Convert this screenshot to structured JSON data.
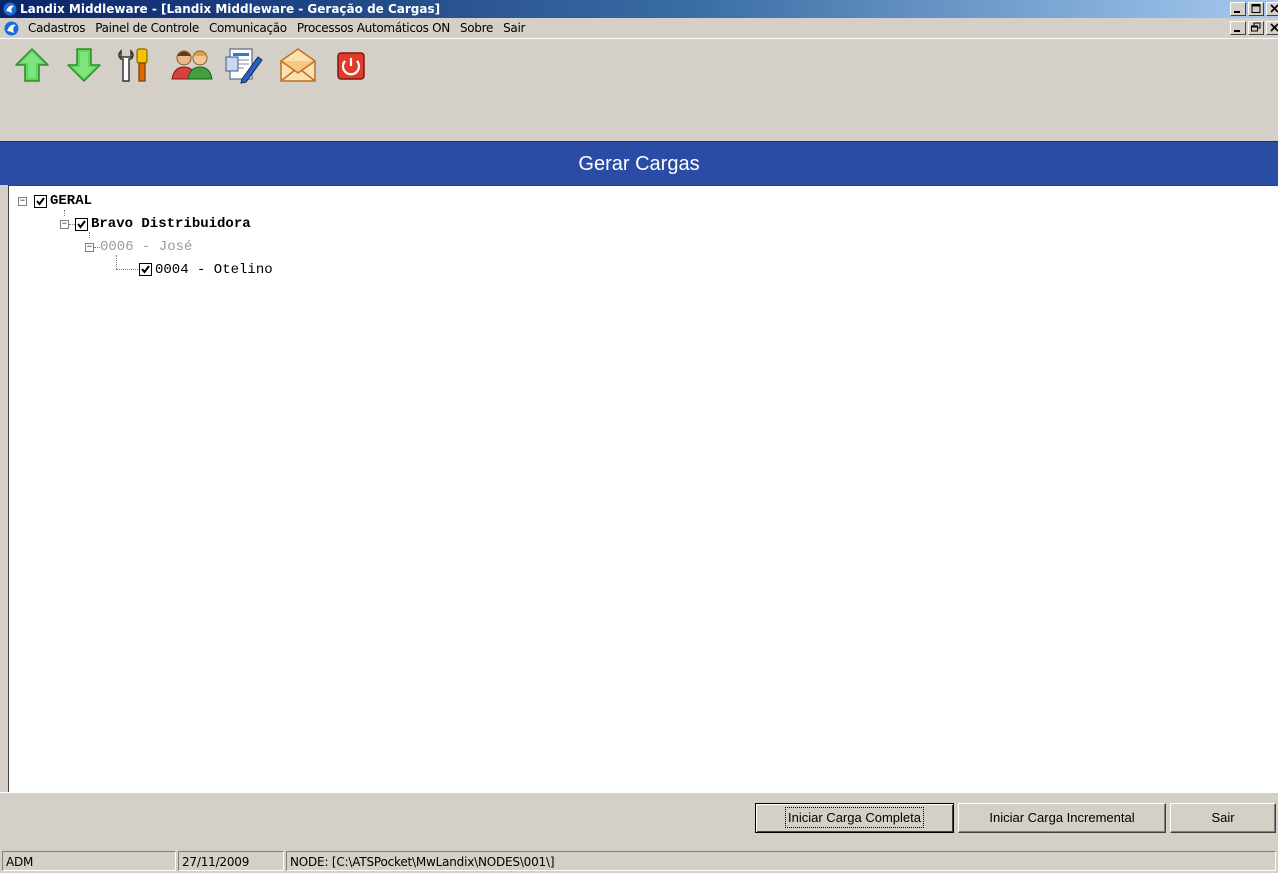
{
  "window": {
    "title": "Landix Middleware - [Landix Middleware - Geração de Cargas]"
  },
  "menu": {
    "items": [
      "Cadastros",
      "Painel de Controle",
      "Comunicação",
      "Processos Automáticos ON",
      "Sobre",
      "Sair"
    ]
  },
  "toolbar": {
    "buttons": [
      {
        "icon": "upload-arrow-icon",
        "color": "#34c234"
      },
      {
        "icon": "download-arrow-icon",
        "color": "#34c234"
      },
      {
        "icon": "tools-icon",
        "color": "#e8a000"
      },
      {
        "icon": "users-icon",
        "color": "#c8782c"
      },
      {
        "icon": "document-edit-icon",
        "color": "#3a78d0"
      },
      {
        "icon": "envelope-icon",
        "color": "#f0a050"
      },
      {
        "icon": "power-icon",
        "color": "#e03c2c"
      }
    ]
  },
  "header": {
    "title": "Gerar Cargas",
    "bg_color": "#2b4ca5"
  },
  "tree": {
    "nodes": [
      {
        "label": "GERAL",
        "checked": true
      },
      {
        "label": "Bravo Distribuidora",
        "checked": true
      },
      {
        "label": "0006 - José",
        "checked": false
      },
      {
        "label": "0004 - Otelino",
        "checked": true
      }
    ]
  },
  "buttons": {
    "full_load": "Iniciar Carga Completa",
    "incremental_load": "Iniciar Carga Incremental",
    "exit": "Sair"
  },
  "statusbar": {
    "user": "ADM",
    "date": "27/11/2009",
    "node": "NODE: [C:\\ATSPocket\\MwLandix\\NODES\\001\\]"
  }
}
